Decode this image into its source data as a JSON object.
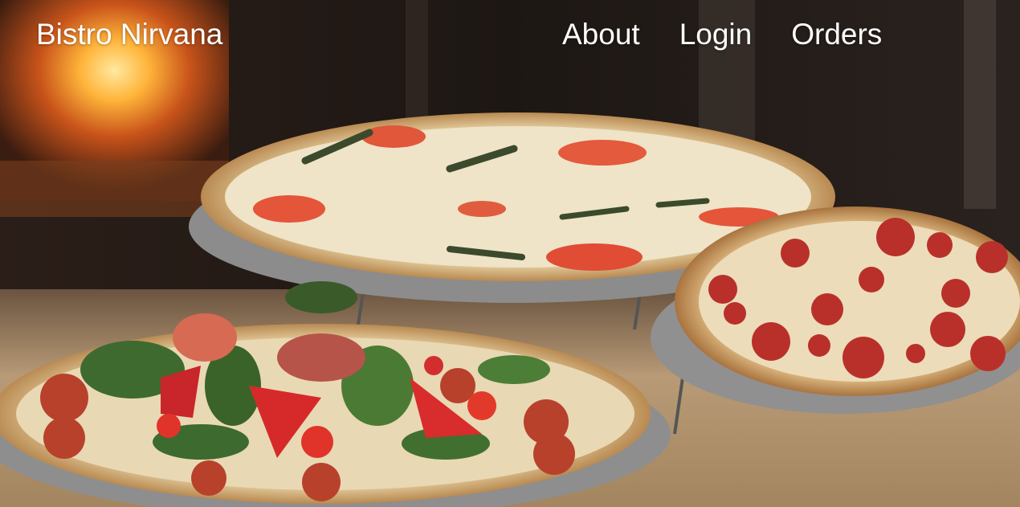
{
  "header": {
    "brand": "Bistro Nirvana",
    "nav": [
      {
        "label": "About"
      },
      {
        "label": "Login"
      },
      {
        "label": "Orders"
      }
    ]
  },
  "hero": {
    "image": "pizza-photo"
  }
}
